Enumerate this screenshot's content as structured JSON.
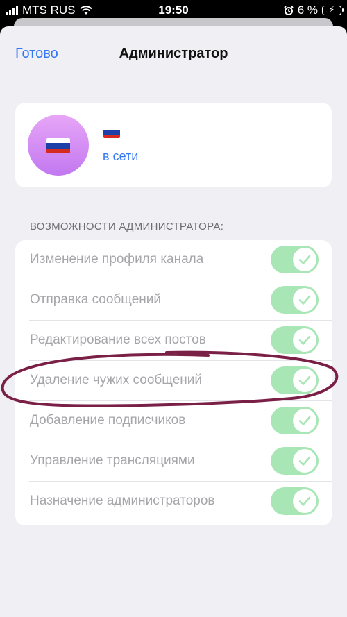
{
  "status_bar": {
    "carrier": "MTS RUS",
    "time": "19:50",
    "battery_percent": "6 %",
    "battery_icon": "battery-charging-icon",
    "wifi_icon": "wifi-icon",
    "alarm_icon": "alarm-icon"
  },
  "nav": {
    "done_label": "Готово",
    "title": "Администратор"
  },
  "profile": {
    "avatar_icon": "russian-flag-icon",
    "name_icon": "russian-flag-icon",
    "status": "в сети"
  },
  "section_header": "ВОЗМОЖНОСТИ АДМИНИСТРАТОРА:",
  "permissions": [
    {
      "label": "Изменение профиля канала",
      "enabled": true
    },
    {
      "label": "Отправка сообщений",
      "enabled": true
    },
    {
      "label": "Редактирование всех постов",
      "enabled": true
    },
    {
      "label": "Удаление чужих сообщений",
      "enabled": true
    },
    {
      "label": "Добавление подписчиков",
      "enabled": true
    },
    {
      "label": "Управление трансляциями",
      "enabled": true
    },
    {
      "label": "Назначение администраторов",
      "enabled": true
    }
  ],
  "colors": {
    "accent": "#3478f6",
    "toggle_on_disabled": "#a9e6b6",
    "annotation": "#7a1f45"
  }
}
